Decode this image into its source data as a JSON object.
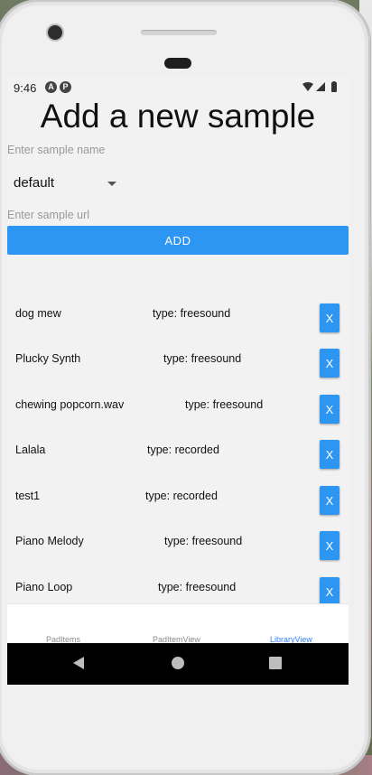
{
  "status": {
    "time": "9:46",
    "icon1": "A",
    "icon2": "P"
  },
  "page": {
    "title": "Add a new sample"
  },
  "form": {
    "name_placeholder": "Enter sample name",
    "type_selected": "default",
    "url_placeholder": "Enter sample url",
    "add_label": "ADD"
  },
  "samples": [
    {
      "name": "dog mew",
      "type": "type: freesound",
      "delete": "X"
    },
    {
      "name": "Plucky Synth",
      "type": "type: freesound",
      "delete": "X"
    },
    {
      "name": "chewing popcorn.wav",
      "type": "type: freesound",
      "delete": "X"
    },
    {
      "name": "Lalala",
      "type": "type: recorded",
      "delete": "X"
    },
    {
      "name": "test1",
      "type": "type: recorded",
      "delete": "X"
    },
    {
      "name": "Piano Melody",
      "type": "type: freesound",
      "delete": "X"
    },
    {
      "name": "Piano Loop",
      "type": "type: freesound",
      "delete": "X"
    }
  ],
  "tabs": [
    {
      "label": "PadItems",
      "active": false
    },
    {
      "label": "PadItemView",
      "active": false
    },
    {
      "label": "LibraryView",
      "active": true
    }
  ],
  "colors": {
    "accent": "#2d96f3",
    "active_tab": "#2d7ff9"
  },
  "icons": [
    "wifi-icon",
    "signal-icon",
    "battery-icon",
    "back-icon",
    "home-icon",
    "recents-icon"
  ]
}
